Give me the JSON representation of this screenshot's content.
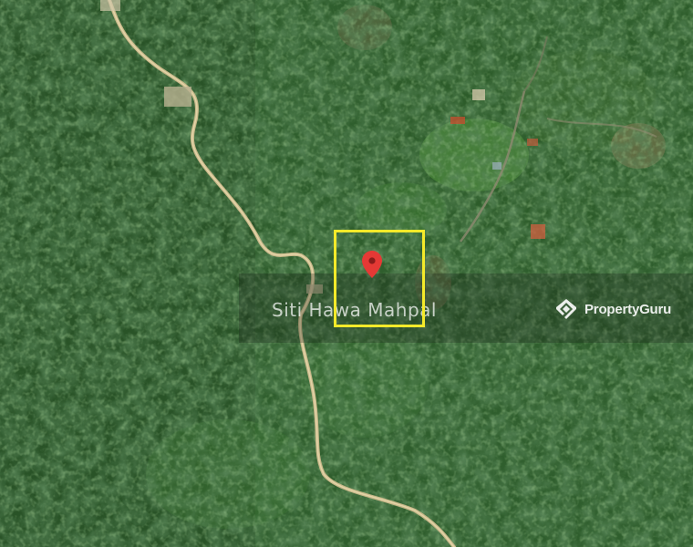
{
  "map": {
    "type": "satellite",
    "watermark": {
      "agent_name": "Siti Hawa Mahpal",
      "brand_name": "PropertyGuru",
      "brand_icon": "propertyguru-logo-icon"
    },
    "selection": {
      "border_color": "#f4ea2a"
    },
    "marker": {
      "icon": "map-pin-icon",
      "color": "#e53935"
    }
  }
}
